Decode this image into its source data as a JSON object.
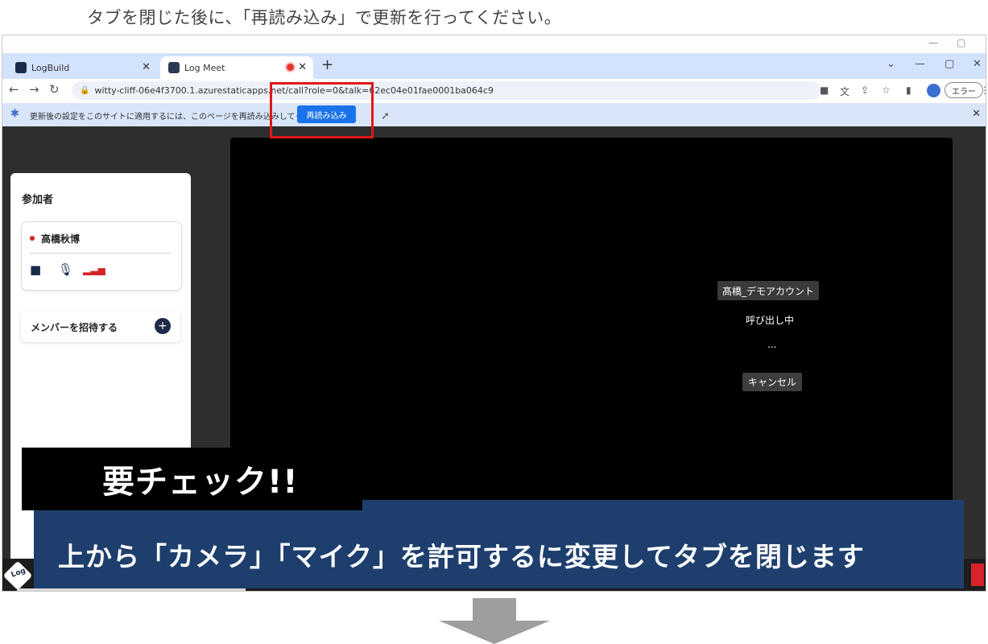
{
  "instruction": "タブを閉じた後に、「再読み込み」で更新を行ってください。",
  "outer_window": {
    "minimize": "—",
    "restore": "▢"
  },
  "browser": {
    "tabs": [
      {
        "label": "LogBuild",
        "close": "✕"
      },
      {
        "label": "Log Meet",
        "close": "✕"
      }
    ],
    "new_tab": "+",
    "tab_controls": {
      "chevron": "⌄",
      "minimize": "—",
      "restore": "▢",
      "close": "✕"
    },
    "nav": {
      "back": "←",
      "forward": "→",
      "reload": "↻"
    },
    "url": "witty-cliff-06e4f3700.1.azurestaticapps.net/call?role=0&talk=62ec04e01fae0001ba064c9",
    "error_pill": "エラー",
    "menu": "⋮",
    "infobar": {
      "message": "更新後の設定をこのサイトに適用するには、このページを再読み込みしてください",
      "reload_button": "再読み込み",
      "close": "✕"
    }
  },
  "sidebar": {
    "title": "参加者",
    "participant": {
      "name": "高橋秋博"
    },
    "invite_label": "メンバーを招待する",
    "invite_plus": "+"
  },
  "call": {
    "callee": "髙橋_デモアカウント",
    "status": "呼び出し中",
    "dots": "...",
    "cancel": "キャンセル"
  },
  "overlay": {
    "check_label": "要チェック!!",
    "caption": "上から「カメラ」「マイク」を許可するに変更してタブを閉じます"
  },
  "logo_text": "Log",
  "colors": {
    "tab_bar": "#d3e3fd",
    "infobar": "#d9e6fa",
    "primary_button": "#1a73e8",
    "caption_bar": "#1e3f6e",
    "highlight": "#e01818",
    "arrow": "#9e9e9e"
  }
}
